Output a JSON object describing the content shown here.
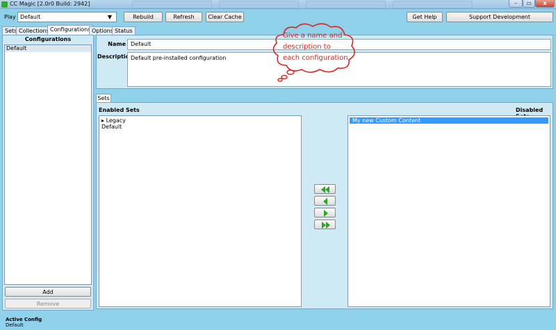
{
  "window": {
    "title": "CC Magic [2.0r0 Build: 2942]",
    "minimize": "–",
    "maximize": "▭",
    "close": "x"
  },
  "toolbar": {
    "play_label": "Play",
    "profile_value": "Default",
    "rebuild": "Rebuild",
    "refresh": "Refresh",
    "clear_cache": "Clear Cache",
    "get_help": "Get Help",
    "support": "Support Development"
  },
  "tabs": [
    {
      "label": "Sets",
      "active": false
    },
    {
      "label": "Collections",
      "active": false
    },
    {
      "label": "Configurations",
      "active": true
    },
    {
      "label": "Options",
      "active": false
    },
    {
      "label": "Status",
      "active": false
    }
  ],
  "configurations": {
    "header": "Configurations",
    "items": [
      "Default"
    ],
    "add_label": "Add",
    "remove_label": "Remove"
  },
  "details": {
    "name_label": "Name",
    "name_value": "Default",
    "description_label": "Description",
    "description_value": "Default pre-installed configuration"
  },
  "sets": {
    "tab_label": "Sets",
    "enabled_header": "Enabled Sets",
    "disabled_header": "Disabled Sets",
    "enabled_items": [
      {
        "label": "Legacy",
        "expander": "▸"
      },
      {
        "label": "Default",
        "expander": ""
      }
    ],
    "disabled_items": [
      "My new Custom Content"
    ]
  },
  "annotation": {
    "lines": [
      "Give a name and",
      "description to",
      "each configuration"
    ],
    "color": "#e0231d"
  },
  "status": {
    "title": "Active Config",
    "value": "Default"
  },
  "icons": {
    "move_all_left": "double-left-arrow-icon",
    "move_left": "left-arrow-icon",
    "move_right": "right-arrow-icon",
    "move_all_right": "double-right-arrow-icon"
  },
  "colors": {
    "background": "#8fd0ea",
    "selection": "#3399ff",
    "arrow": "#22aa22"
  }
}
